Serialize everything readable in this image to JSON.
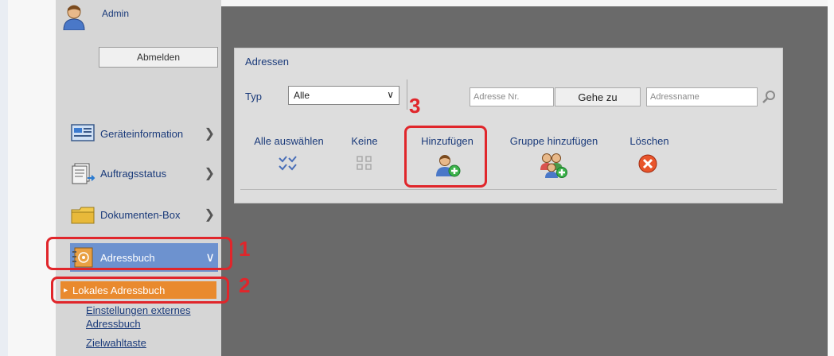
{
  "sidebar": {
    "user": "Admin",
    "logout_label": "Abmelden",
    "items": [
      {
        "label": "Geräteinformation",
        "icon": "device-info-icon"
      },
      {
        "label": "Auftragsstatus",
        "icon": "job-status-icon"
      },
      {
        "label": "Dokumenten-Box",
        "icon": "document-box-icon"
      },
      {
        "label": "Adressbuch",
        "icon": "address-book-icon",
        "active": true
      }
    ],
    "subitems": [
      {
        "label": "Lokales Adressbuch",
        "active": true
      },
      {
        "label": "Einstellungen externes Adressbuch"
      },
      {
        "label": "Zielwahltaste"
      }
    ]
  },
  "panel": {
    "title": "Adressen",
    "typ_label": "Typ",
    "typ_value": "Alle",
    "address_nr_placeholder": "Adresse Nr.",
    "goto_label": "Gehe zu",
    "address_name_placeholder": "Adressname",
    "actions": {
      "select_all": "Alle auswählen",
      "none": "Keine",
      "add": "Hinzufügen",
      "add_group": "Gruppe hinzufügen",
      "delete": "Löschen"
    }
  },
  "steps": [
    "1",
    "2",
    "3"
  ],
  "colors": {
    "accent_blue": "#6d92cf",
    "active_orange": "#e98a2e",
    "callout_red": "#e0262b",
    "link": "#1a3a7a"
  }
}
